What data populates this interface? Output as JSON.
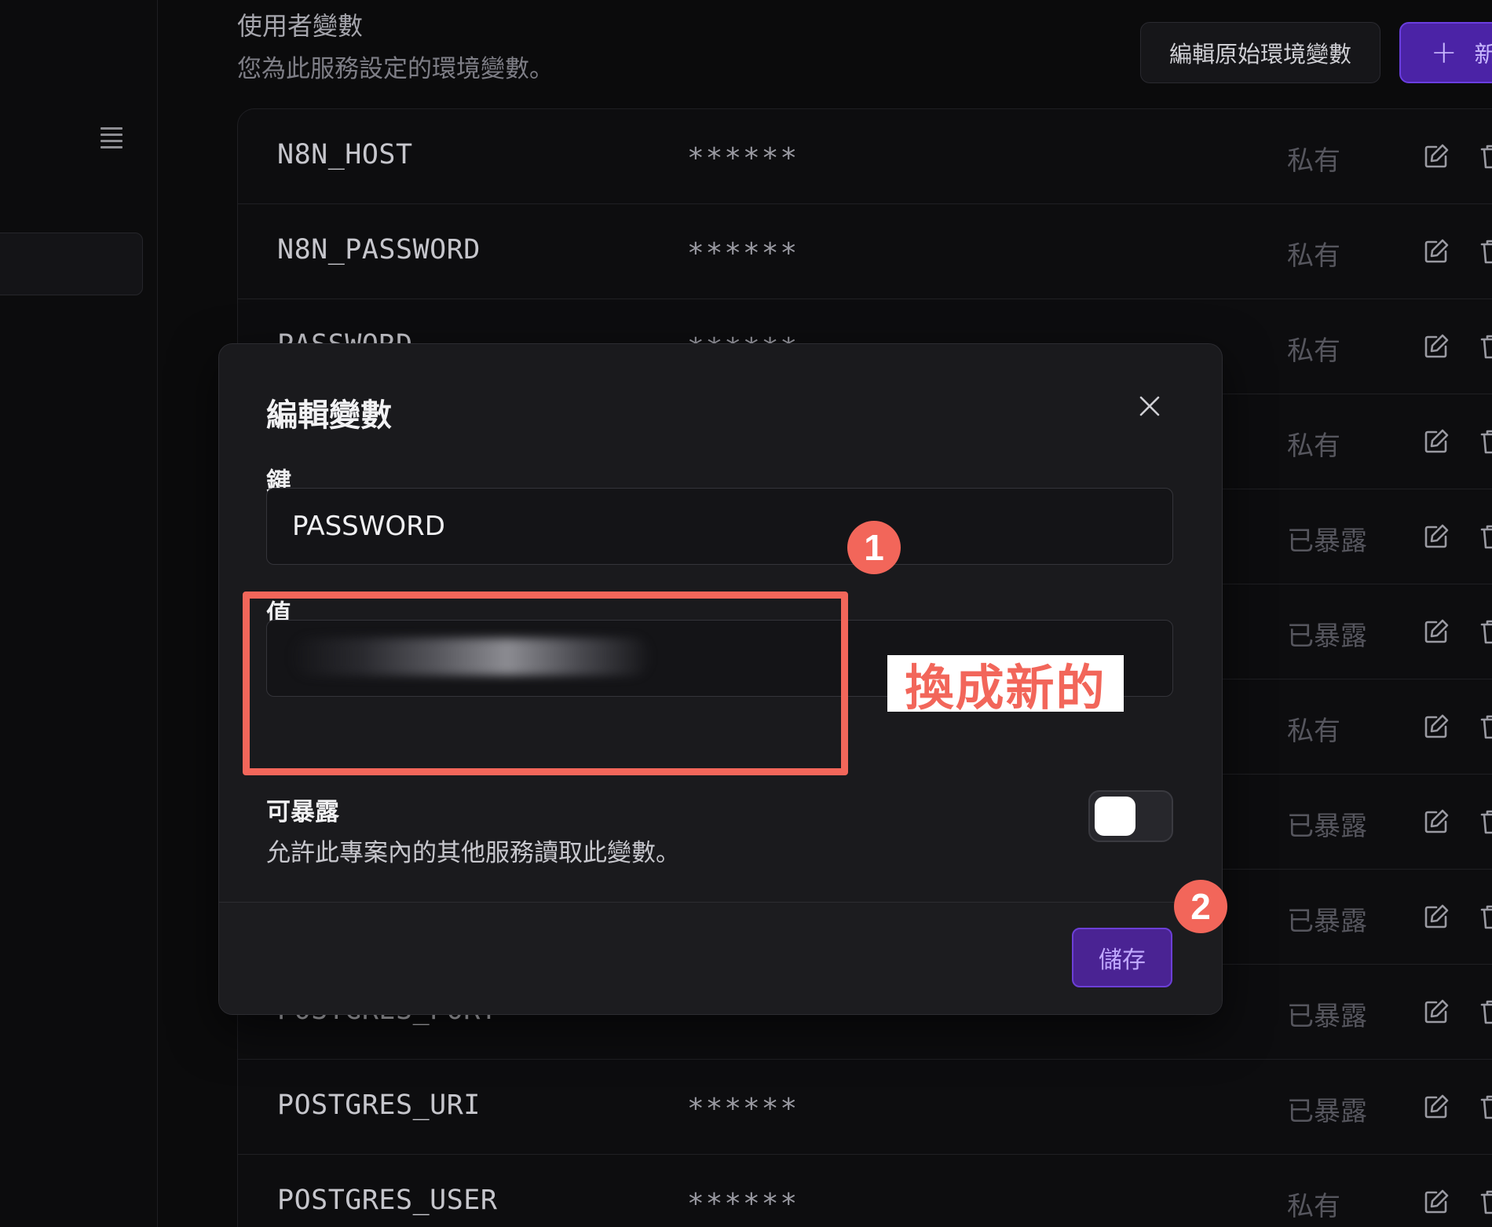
{
  "sidebar": {
    "menu_icon": "hamburger-menu-icon"
  },
  "header": {
    "title": "使用者變數",
    "subtitle": "您為此服務設定的環境變數。",
    "raw_edit_label": "編輯原始環境變數",
    "new_button_label": "新"
  },
  "variables": [
    {
      "key": "N8N_HOST",
      "value": "******",
      "visibility": "私有"
    },
    {
      "key": "N8N_PASSWORD",
      "value": "******",
      "visibility": "私有"
    },
    {
      "key": "PASSWORD",
      "value": "******",
      "visibility": "私有"
    },
    {
      "key": "",
      "value": "",
      "visibility": "私有"
    },
    {
      "key": "",
      "value": "",
      "visibility": "已暴露"
    },
    {
      "key": "",
      "value": "",
      "visibility": "已暴露"
    },
    {
      "key": "",
      "value": "",
      "visibility": "私有"
    },
    {
      "key": "",
      "value": "",
      "visibility": "已暴露"
    },
    {
      "key": "",
      "value": "",
      "visibility": "已暴露"
    },
    {
      "key": "POSTGRES_PORT",
      "value": "******",
      "visibility": "已暴露"
    },
    {
      "key": "POSTGRES_URI",
      "value": "******",
      "visibility": "已暴露"
    },
    {
      "key": "POSTGRES_USER",
      "value": "******",
      "visibility": "私有"
    }
  ],
  "dialog": {
    "title": "編輯變數",
    "key_label": "鍵",
    "key_value": "PASSWORD",
    "value_label": "值",
    "expose_label": "可暴露",
    "expose_description": "允許此專案內的其他服務讀取此變數。",
    "expose_enabled": false,
    "save_label": "儲存"
  },
  "annotations": {
    "badge_1": "1",
    "badge_2": "2",
    "callout": "換成新的",
    "color": "#f2665a"
  },
  "colors": {
    "accent": "#4b23a6",
    "background": "#0b0b0c",
    "dialog": "#1a1a1d"
  }
}
